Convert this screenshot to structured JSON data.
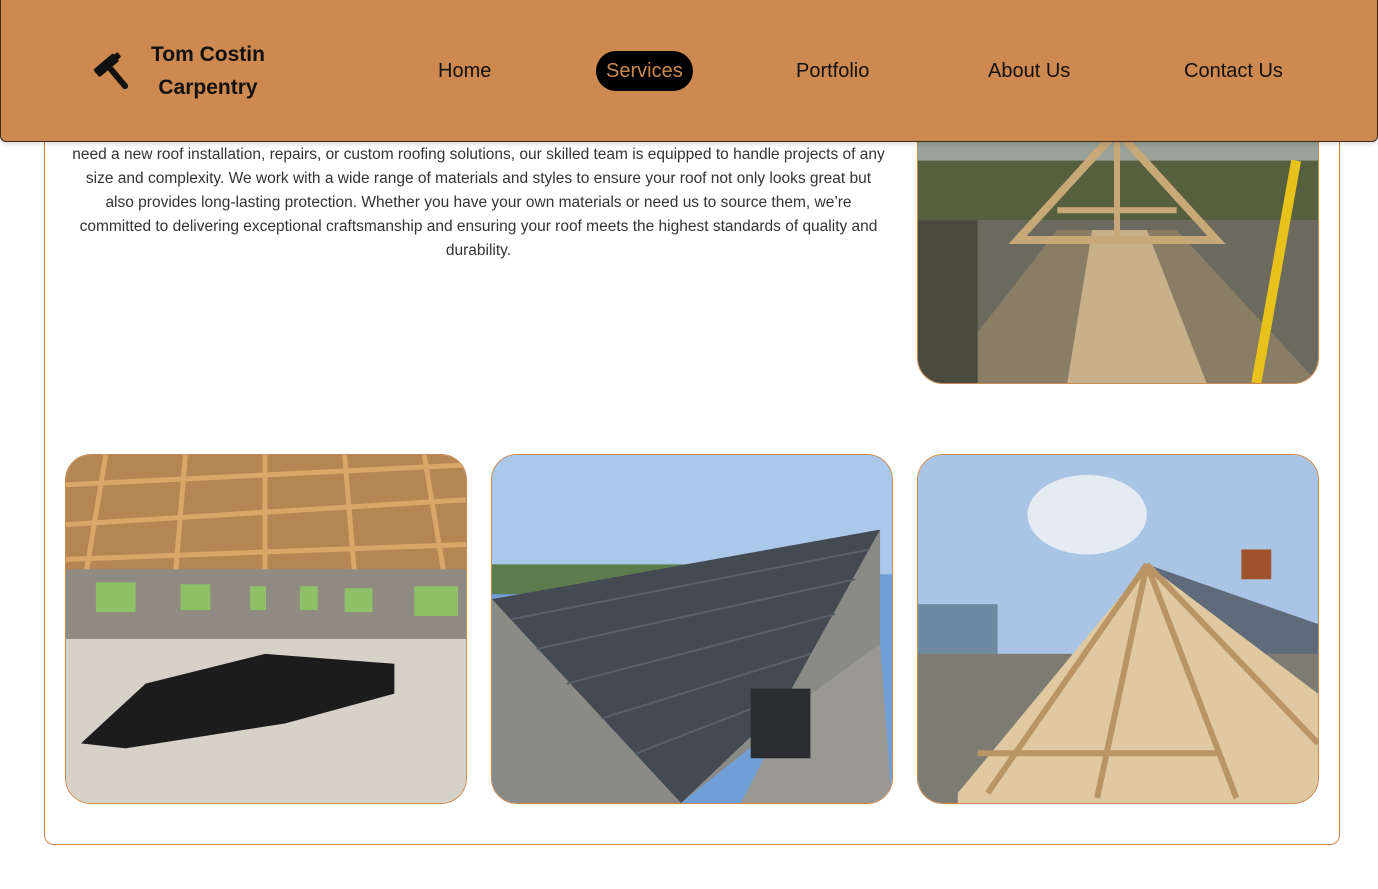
{
  "brand": {
    "line1": "Tom Costin",
    "line2": "Carpentry",
    "logo_icon": "hammer-icon"
  },
  "nav": {
    "items": [
      {
        "label": "Home",
        "active": false
      },
      {
        "label": "Services",
        "active": true
      },
      {
        "label": "Portfolio",
        "active": false
      },
      {
        "label": "About Us",
        "active": false
      },
      {
        "label": "Contact Us",
        "active": false
      }
    ]
  },
  "section": {
    "description": "need a new roof installation, repairs, or custom roofing solutions, our skilled team is equipped to handle projects of any size and complexity. We work with a wide range of materials and styles to ensure your roof not only looks great but also provides long-lasting protection. Whether you have your own materials or need us to source them, we’re committed to delivering exceptional craftsmanship and ensuring your roof meets the highest standards of quality and durability."
  },
  "gallery": [
    "roof-trusses-photo",
    "interior-trusses-photo",
    "slate-roof-photo",
    "hip-roof-frame-photo"
  ],
  "colors": {
    "accent": "#cd894f",
    "active_bg": "#000000",
    "active_text": "#cd894f"
  }
}
